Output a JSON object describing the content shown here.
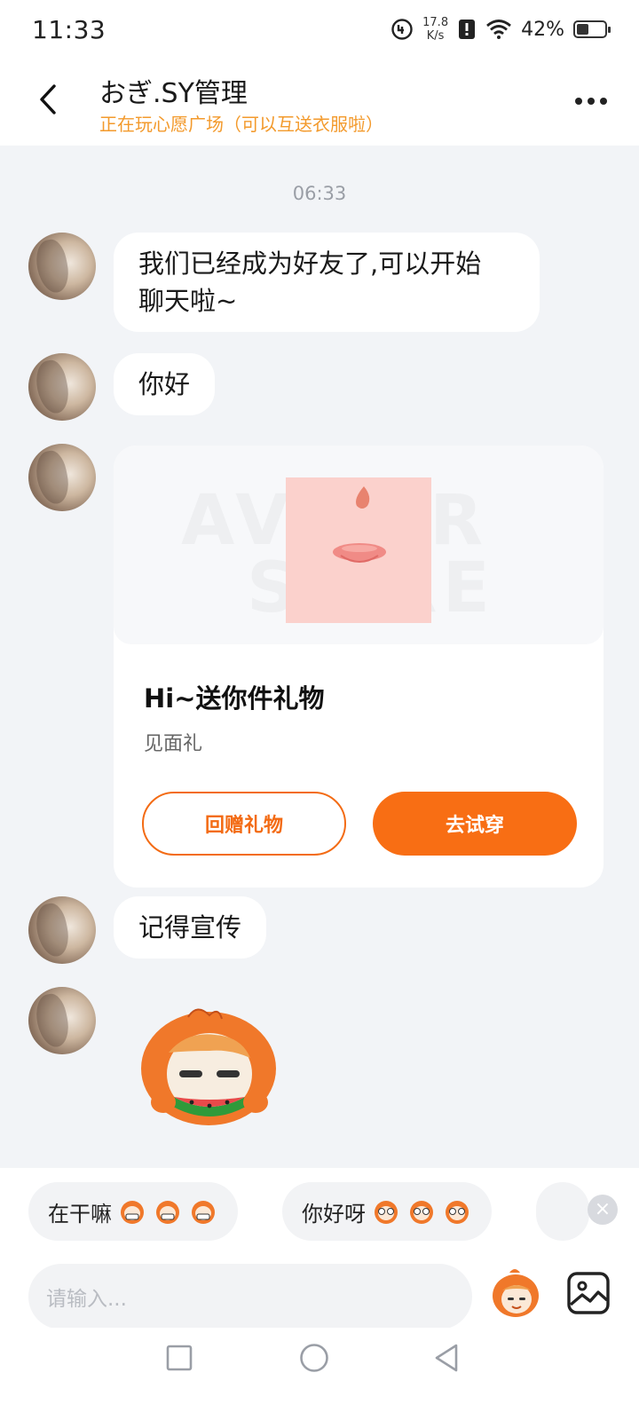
{
  "status_bar": {
    "time": "11:33",
    "net_speed_value": "17.8",
    "net_speed_unit": "K/s",
    "battery_pct": "42%",
    "battery_level": 0.42
  },
  "header": {
    "title": "おぎ.SY管理",
    "subtitle": "正在玩心愿广场（可以互送衣服啦）"
  },
  "chat": {
    "timestamp": "06:33",
    "messages": [
      {
        "text_line1": "我们已经成为好友了,可以开始",
        "text_line2": "聊天啦~"
      },
      {
        "text": "你好"
      },
      {
        "text": "记得宣传"
      }
    ],
    "gift_card": {
      "title": "Hi~送你件礼物",
      "subtitle": "见面礼",
      "secondary_button": "回赠礼物",
      "primary_button": "去试穿"
    }
  },
  "quick_replies": [
    {
      "label": "在干嘛"
    },
    {
      "label": "你好呀"
    }
  ],
  "input": {
    "placeholder": "请输入..."
  },
  "colors": {
    "accent": "#f86e14",
    "subtitle": "#f39a2c",
    "chat_bg": "#f2f4f7"
  },
  "icons": {
    "back": "chevron-left-icon",
    "more": "more-dots-icon",
    "emoji": "emoji-sticker-icon",
    "image": "image-icon",
    "close": "close-icon"
  }
}
